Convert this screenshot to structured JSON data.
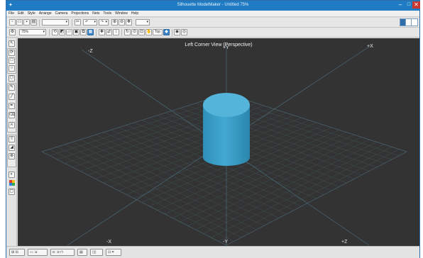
{
  "window": {
    "title": "Silhouette ModelMaker - Untitled 75%",
    "app_icon": "silhouette-app-icon",
    "minimize_glyph": "–",
    "maximize_glyph": "□",
    "close_glyph": "✕"
  },
  "menu": [
    "File",
    "Edit",
    "Style",
    "Arrange",
    "Camera",
    "Projections",
    "Nets",
    "Tools",
    "Window",
    "Help"
  ],
  "toolbar": {
    "zoom_value": "75%",
    "view_mode_button": "Top"
  },
  "viewport": {
    "title": "Left Corner View (Perspective)",
    "axis_labels": {
      "neg_z": "-Z",
      "pos_y": "+Y",
      "pos_x": "+X",
      "neg_x": "-X",
      "neg_y": "-Y",
      "pos_z": "+Z"
    },
    "background_color": "#333333",
    "grid_color": "#4a6470",
    "model": {
      "shape": "cylinder",
      "color": "#3a9fc6"
    }
  }
}
